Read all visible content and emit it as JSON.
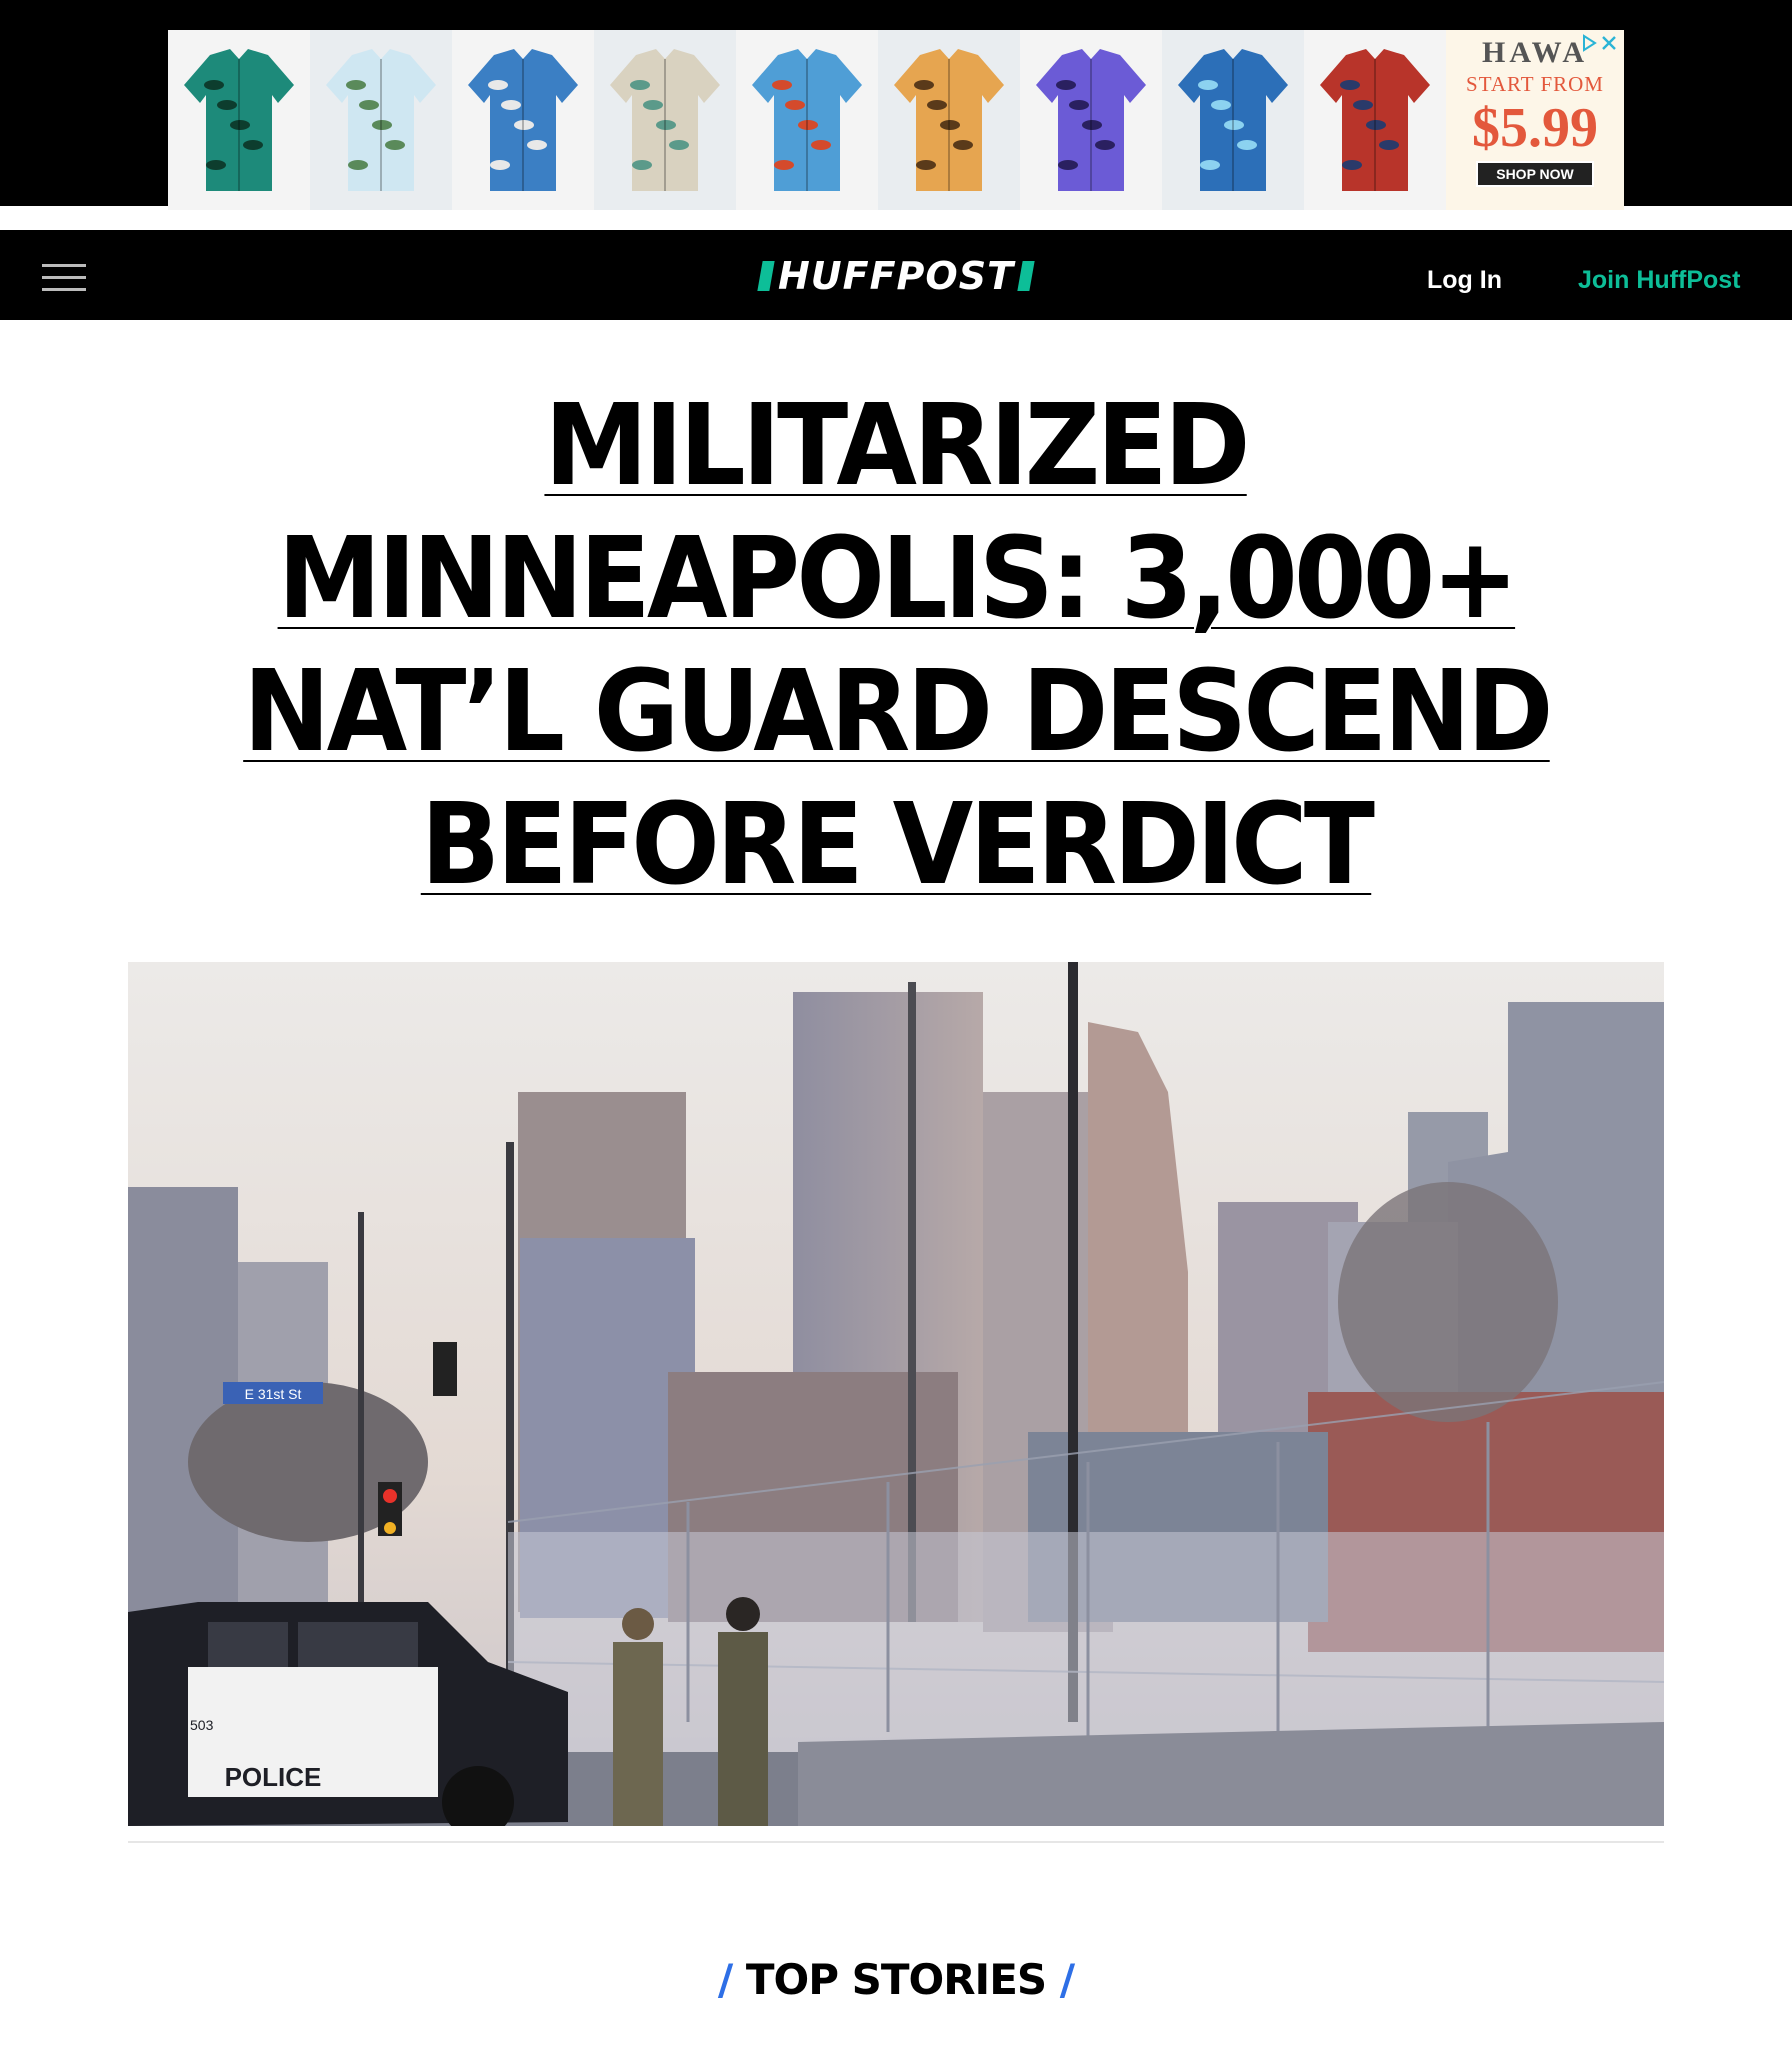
{
  "ad": {
    "brand": "HAWA",
    "start_text": "START FROM",
    "price": "$5.99",
    "cta": "SHOP NOW",
    "shirts": [
      {
        "bg": "#1d8a7a",
        "accent": "#0d3d2e"
      },
      {
        "bg": "#cfe7f2",
        "accent": "#5a8a5a"
      },
      {
        "bg": "#3b7fc4",
        "accent": "#e8e8e8"
      },
      {
        "bg": "#d9d2c0",
        "accent": "#5b9a8a"
      },
      {
        "bg": "#4f9ed6",
        "accent": "#d44a2c"
      },
      {
        "bg": "#e6a550",
        "accent": "#5a3a1a"
      },
      {
        "bg": "#6b5bd6",
        "accent": "#2a2060"
      },
      {
        "bg": "#2c6fb8",
        "accent": "#8cd2f0"
      },
      {
        "bg": "#b8342a",
        "accent": "#2a3a6a"
      }
    ]
  },
  "header": {
    "logo": "HUFFPOST",
    "login": "Log In",
    "join": "Join HuffPost"
  },
  "headline": {
    "line1": "MILITARIZED",
    "line2": "MINNEAPOLIS: 3,000+",
    "line3": "NAT’L GUARD DESCEND",
    "line4": "BEFORE VERDICT"
  },
  "hero": {
    "street_sign": "E 31st St",
    "police_text": "POLICE",
    "car_number": "503"
  },
  "section": {
    "top_stories": "TOP STORIES"
  },
  "colors": {
    "brand_green": "#0dbe98",
    "accent_blue": "#2e6fe6"
  }
}
